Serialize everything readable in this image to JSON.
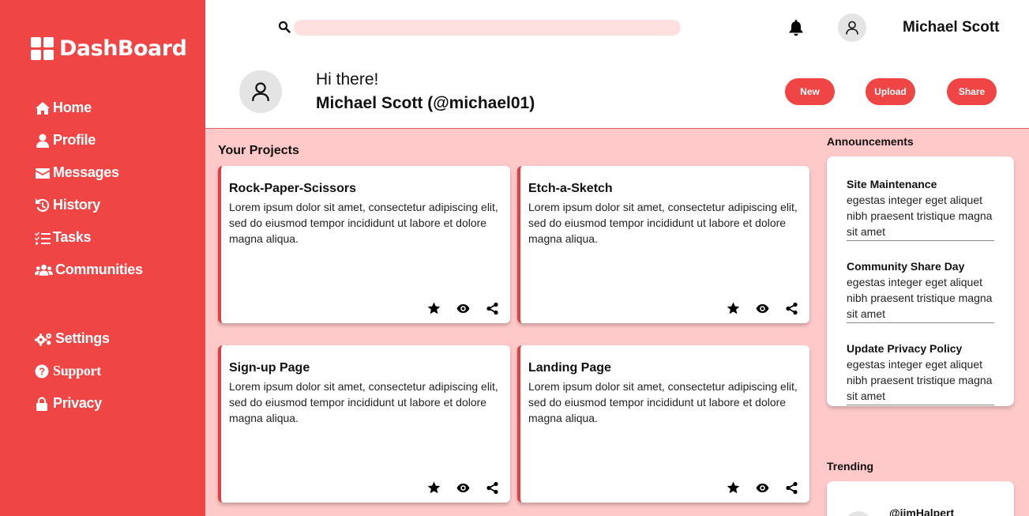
{
  "sidebar": {
    "logo_text": "DashBoard",
    "nav": [
      {
        "label": "Home",
        "icon": "home-icon"
      },
      {
        "label": "Profile",
        "icon": "user-icon"
      },
      {
        "label": "Messages",
        "icon": "envelope-icon"
      },
      {
        "label": "History",
        "icon": "history-icon"
      },
      {
        "label": "Tasks",
        "icon": "tasks-icon"
      },
      {
        "label": "Communities",
        "icon": "users-icon"
      }
    ],
    "nav_secondary": [
      {
        "label": "Settings",
        "icon": "gears-icon"
      },
      {
        "label": "Support",
        "icon": "question-circle-icon"
      },
      {
        "label": "Privacy",
        "icon": "lock-icon"
      }
    ]
  },
  "header": {
    "search_placeholder": "",
    "user_name": "Michael Scott",
    "greeting": "Hi there!",
    "user_handle": "Michael Scott (@michael01)",
    "buttons": {
      "new": "New",
      "upload": "Upload",
      "share": "Share"
    }
  },
  "projects": {
    "title": "Your Projects",
    "items": [
      {
        "title": "Rock-Paper-Scissors",
        "description": "Lorem ipsum dolor sit amet, consectetur adipiscing elit, sed do eiusmod tempor incididunt ut labore et dolore magna aliqua."
      },
      {
        "title": "Etch-a-Sketch",
        "description": "Lorem ipsum dolor sit amet, consectetur adipiscing elit, sed do eiusmod tempor incididunt ut labore et dolore magna aliqua."
      },
      {
        "title": "Sign-up Page",
        "description": "Lorem ipsum dolor sit amet, consectetur adipiscing elit, sed do eiusmod tempor incididunt ut labore et dolore magna aliqua."
      },
      {
        "title": "Landing Page",
        "description": "Lorem ipsum dolor sit amet, consectetur adipiscing elit, sed do eiusmod tempor incididunt ut labore et dolore magna aliqua."
      }
    ]
  },
  "announcements": {
    "title": "Announcements",
    "items": [
      {
        "title": "Site Maintenance",
        "text": "egestas integer eget aliquet nibh praesent tristique magna sit amet"
      },
      {
        "title": "Community Share Day",
        "text": "egestas integer eget aliquet nibh praesent tristique magna sit amet"
      },
      {
        "title": "Update Privacy Policy",
        "text": "egestas integer eget aliquet nibh praesent tristique magna sit amet"
      }
    ]
  },
  "trending": {
    "title": "Trending",
    "items": [
      {
        "user": "@jimHalpert"
      }
    ]
  },
  "colors": {
    "accent": "#f04545",
    "background": "#ffc9c9",
    "search_bg": "#ffe0e0"
  }
}
